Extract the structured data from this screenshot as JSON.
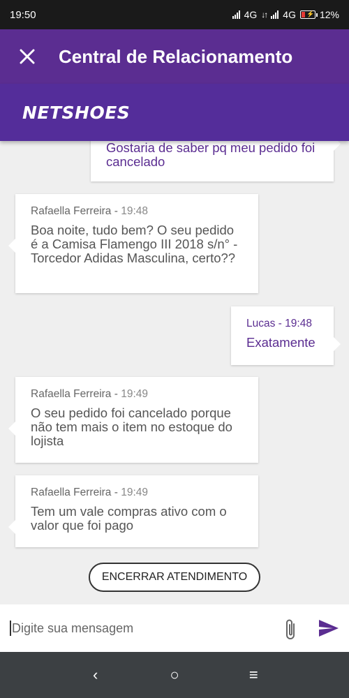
{
  "status_bar": {
    "time": "19:50",
    "net1": "4G",
    "net2": "4G",
    "battery": "12%"
  },
  "app_bar": {
    "title": "Central de Relacionamento",
    "close_icon": "close-icon"
  },
  "brand": {
    "logo_text": "NETSHOES"
  },
  "messages": [
    {
      "side": "right",
      "author": "",
      "time": "",
      "text": "Gostaria de saber pq meu pedido foi cancelado"
    },
    {
      "side": "left",
      "author": "Rafaella Ferreira",
      "time": "19:48",
      "text": "Boa noite, tudo bem? O seu pedido é a Camisa Flamengo III 2018 s/n° - Torcedor Adidas Masculina, certo??"
    },
    {
      "side": "right",
      "author": "Lucas",
      "time": "19:48",
      "text": "Exatamente"
    },
    {
      "side": "left",
      "author": "Rafaella Ferreira",
      "time": "19:49",
      "text": "O seu pedido foi cancelado porque não tem mais o item no estoque do lojista"
    },
    {
      "side": "left",
      "author": "Rafaella Ferreira",
      "time": "19:49",
      "text": "Tem um vale compras ativo com o valor que foi pago"
    }
  ],
  "end_button": {
    "label": "ENCERRAR ATENDIMENTO"
  },
  "composer": {
    "placeholder": "Digite sua mensagem",
    "attach_icon": "paperclip-icon",
    "send_icon": "send-icon"
  },
  "nav": {
    "back": "‹",
    "home": "○",
    "menu": "≡"
  },
  "colors": {
    "primary": "#5b2d91",
    "brand_bar": "#542d9a",
    "nav_bar": "#3c4043"
  }
}
